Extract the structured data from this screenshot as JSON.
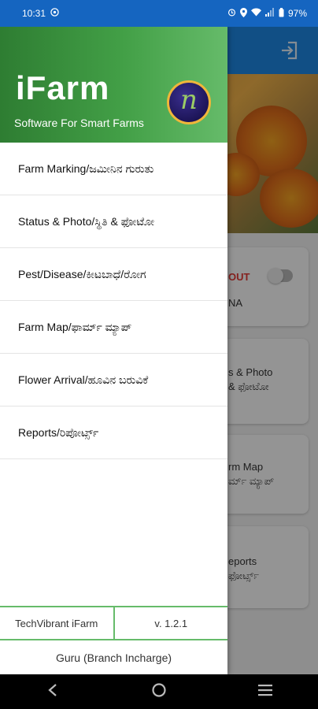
{
  "status_bar": {
    "time": "10:31",
    "battery": "97%",
    "icons": [
      "whatsapp-icon",
      "alarm-icon",
      "location-icon",
      "wifi-icon",
      "signal-icon",
      "battery-icon"
    ]
  },
  "background": {
    "logout_label": "OUT",
    "card1_sub": "NA",
    "card2_line1": "s & Photo",
    "card2_line2": "& ಫೋಟೋ",
    "card3_line1": "rm Map",
    "card3_line2": "ರ್ಮ್ ಮ್ಯಾಪ್",
    "card4_line1": "eports",
    "card4_line2": "ಫೋರ್ಟ್ಸ್"
  },
  "drawer": {
    "title": "iFarm",
    "subtitle": "Software For Smart Farms",
    "logo_letter": "n",
    "menu": [
      {
        "label": "Farm Marking/ಜಮೀನಿನ ಗುರುತು"
      },
      {
        "label": "Status & Photo/ಸ್ಥಿತಿ & ಫೋಟೋ"
      },
      {
        "label": "Pest/Disease/ಕೀಟಬಾಧೆ/ರೋಗ"
      },
      {
        "label": "Farm Map/ಫಾರ್ಮ್ ಮ್ಯಾಪ್"
      },
      {
        "label": "Flower Arrival/ಹೂವಿನ ಬರುವಿಕೆ"
      },
      {
        "label": "Reports/ರಿಪೋರ್ಟ್ಸ್"
      }
    ],
    "footer": {
      "company": "TechVibrant iFarm",
      "version": "v. 1.2.1",
      "user": "Guru (Branch Incharge)"
    }
  },
  "colors": {
    "header_green": "#43a047",
    "footer_border": "#66bb6a",
    "appbar_blue": "#1e88e5",
    "logout_red": "#e53935"
  }
}
